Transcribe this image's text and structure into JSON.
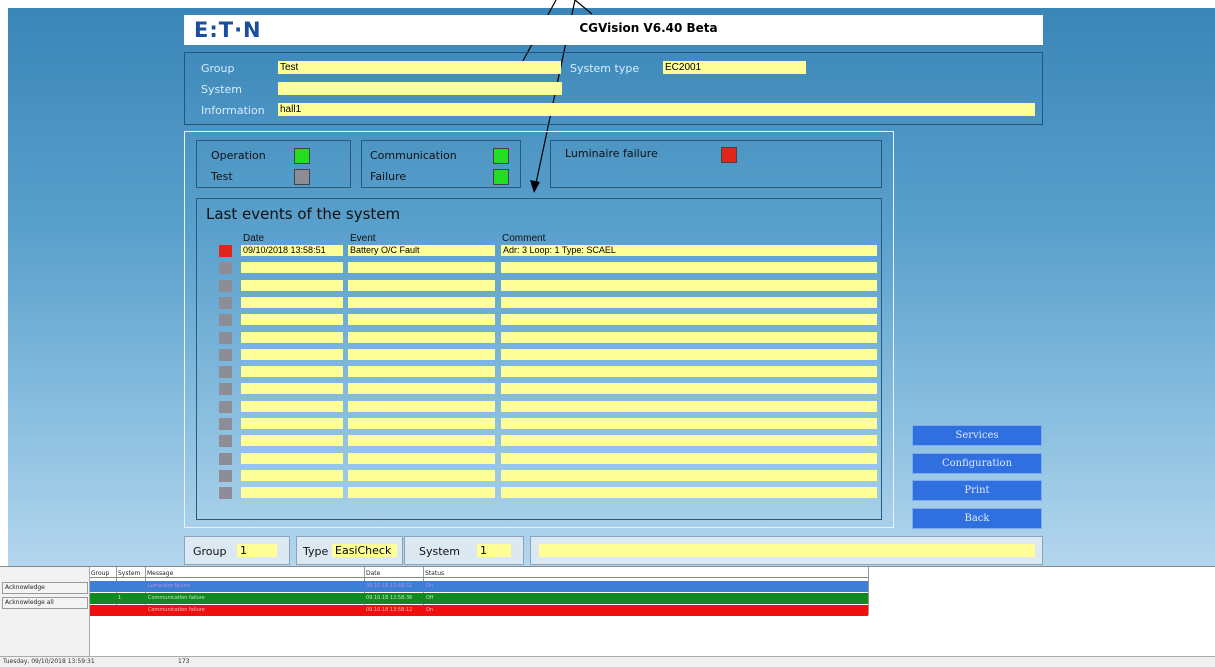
{
  "header": {
    "logo": "E:T·N",
    "title": "CGVision V6.40 Beta"
  },
  "info": {
    "group_label": "Group",
    "group_value": "Test",
    "system_type_label": "System type",
    "system_type_value": "EC2001",
    "system_label": "System",
    "system_value": "",
    "information_label": "Information",
    "information_value": "hall1"
  },
  "status": {
    "operation_label": "Operation",
    "test_label": "Test",
    "communication_label": "Communication",
    "failure_label": "Failure",
    "luminaire_failure_label": "Luminaire failure",
    "colors": {
      "operation": "#22dd22",
      "test": "#8d8d98",
      "communication": "#22dd22",
      "failure": "#22dd22",
      "luminaire_failure": "#e1251b"
    }
  },
  "events": {
    "title": "Last events of the system",
    "headers": {
      "date": "Date",
      "event": "Event",
      "comment": "Comment"
    },
    "rows": [
      {
        "date": "09/10/2018 13:58:51",
        "event": "Battery O/C Fault",
        "comment": "Adr: 3  Loop: 1  Type: SCAEL",
        "state": "red"
      },
      {
        "date": "",
        "event": "",
        "comment": "",
        "state": "grey"
      },
      {
        "date": "",
        "event": "",
        "comment": "",
        "state": "grey"
      },
      {
        "date": "",
        "event": "",
        "comment": "",
        "state": "grey"
      },
      {
        "date": "",
        "event": "",
        "comment": "",
        "state": "grey"
      },
      {
        "date": "",
        "event": "",
        "comment": "",
        "state": "grey"
      },
      {
        "date": "",
        "event": "",
        "comment": "",
        "state": "grey"
      },
      {
        "date": "",
        "event": "",
        "comment": "",
        "state": "grey"
      },
      {
        "date": "",
        "event": "",
        "comment": "",
        "state": "grey"
      },
      {
        "date": "",
        "event": "",
        "comment": "",
        "state": "grey"
      },
      {
        "date": "",
        "event": "",
        "comment": "",
        "state": "grey"
      },
      {
        "date": "",
        "event": "",
        "comment": "",
        "state": "grey"
      },
      {
        "date": "",
        "event": "",
        "comment": "",
        "state": "grey"
      },
      {
        "date": "",
        "event": "",
        "comment": "",
        "state": "grey"
      },
      {
        "date": "",
        "event": "",
        "comment": "",
        "state": "grey"
      }
    ]
  },
  "side_buttons": {
    "services": "Services",
    "configuration": "Configuration",
    "print": "Print",
    "back": "Back"
  },
  "bottom": {
    "group_label": "Group",
    "group_value": "1",
    "type_label": "Type",
    "type_value": "EasiCheck",
    "system_label": "System",
    "system_value": "1",
    "message_value": ""
  },
  "alarms": {
    "acknowledge": "Acknowledge",
    "acknowledge_all": "Acknowledge all",
    "headers": {
      "group": "Group",
      "system": "System",
      "message": "Message",
      "date": "Date",
      "status": "Status"
    },
    "rows": [
      {
        "group": "",
        "system": "",
        "message": "Luminaire failure",
        "date": "09.10.18 13:58:51",
        "status": "On",
        "bg": "#3e7fd6",
        "fg": "#b98ee0"
      },
      {
        "group": "",
        "system": "1",
        "message": "Communication failure",
        "date": "09.10.18 13:58:36",
        "status": "Off",
        "bg": "#0f8a1f",
        "fg": "#c9e6c9"
      },
      {
        "group": "",
        "system": "",
        "message": "Communication failure",
        "date": "09.10.18 13:58:12",
        "status": "On",
        "bg": "#f00f0f",
        "fg": "#f6c0c0"
      }
    ]
  },
  "statusbar": {
    "datetime": "Tuesday, 09/10/2018 13:59:31",
    "count": "173"
  }
}
